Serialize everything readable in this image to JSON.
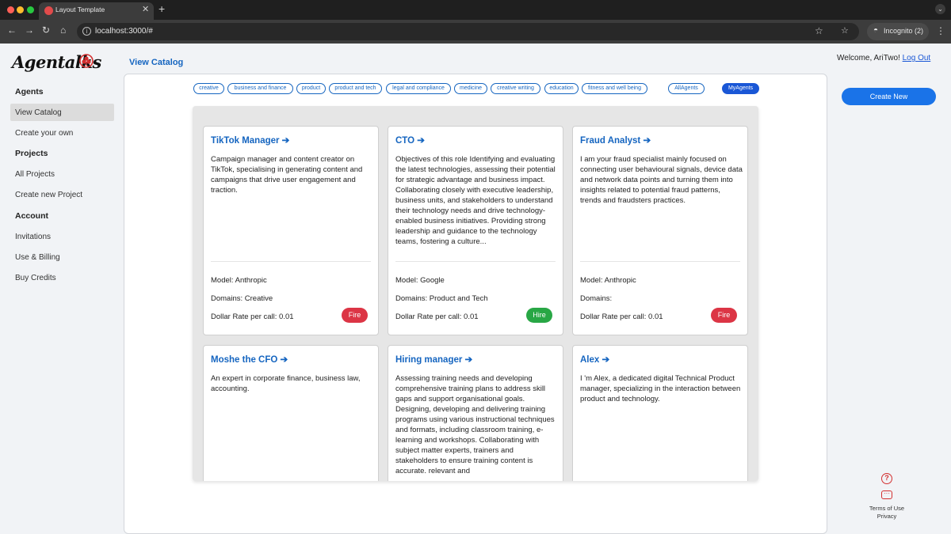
{
  "browser": {
    "tab_title": "Layout Template",
    "url": "localhost:3000/#",
    "incognito_label": "Incognito (2)"
  },
  "app": {
    "logo_text": "Agentalks",
    "section_title": "View Catalog",
    "welcome_text": "Welcome, AriTwo!",
    "logout_label": "Log Out",
    "create_new_label": "Create New"
  },
  "sidebar": {
    "agents_heading": "Agents",
    "view_catalog": "View Catalog",
    "create_your_own": "Create your own",
    "projects_heading": "Projects",
    "all_projects": "All Projects",
    "create_new_project": "Create new Project",
    "account_heading": "Account",
    "invitations": "Invitations",
    "use_billing": "Use & Billing",
    "buy_credits": "Buy Credits"
  },
  "filters": [
    "creative",
    "business and finance",
    "product",
    "product and tech",
    "legal and compliance",
    "medicine",
    "creative writing",
    "education",
    "fitness and well being",
    "AllAgents",
    "MyAgents"
  ],
  "selected_filter": "MyAgents",
  "cards": [
    {
      "title": "TikTok Manager ➔",
      "description": "Campaign manager and content creator on TikTok, specialising in generating content and campaigns that drive user engagement and traction.",
      "model": "Model: Anthropic",
      "domains": "Domains: Creative",
      "rate": "Dollar Rate per call: 0.01",
      "action": "Fire"
    },
    {
      "title": "CTO ➔",
      "description": "Objectives of this role Identifying and evaluating the latest technologies, assessing their potential for strategic advantage and business impact. Collaborating closely with executive leadership, business units, and stakeholders to understand their technology needs and drive technology-enabled business initiatives. Providing strong leadership and guidance to the technology teams, fostering a culture...",
      "model": "Model: Google",
      "domains": "Domains: Product and Tech",
      "rate": "Dollar Rate per call: 0.01",
      "action": "Hire"
    },
    {
      "title": "Fraud Analyst ➔",
      "description": "I am your fraud specialist mainly focused on connecting user behavioural signals, device data and network data points and turning them into insights related to potential fraud patterns, trends and fraudsters practices.",
      "model": "Model: Anthropic",
      "domains": "Domains:",
      "rate": "Dollar Rate per call: 0.01",
      "action": "Fire"
    },
    {
      "title": "Moshe the CFO ➔",
      "description": "An expert in corporate finance, business law, accounting."
    },
    {
      "title": "Hiring manager ➔",
      "description": "Assessing training needs and developing comprehensive training plans to address skill gaps and support organisational goals. Designing, developing and delivering training programs using various instructional techniques and formats, including classroom training, e-learning and workshops. Collaborating with subject matter experts, trainers and stakeholders to ensure training content is accurate, relevant and"
    },
    {
      "title": "Alex ➔",
      "description": "I 'm Alex, a dedicated digital Technical Product manager, specializing in the interaction between product and technology."
    }
  ],
  "footer": {
    "terms": "Terms of Use",
    "privacy": "Privacy"
  },
  "colors": {
    "accent": "#1a57d6",
    "title_blue": "#1565c0",
    "fire": "#dc3545",
    "hire": "#28a745"
  }
}
